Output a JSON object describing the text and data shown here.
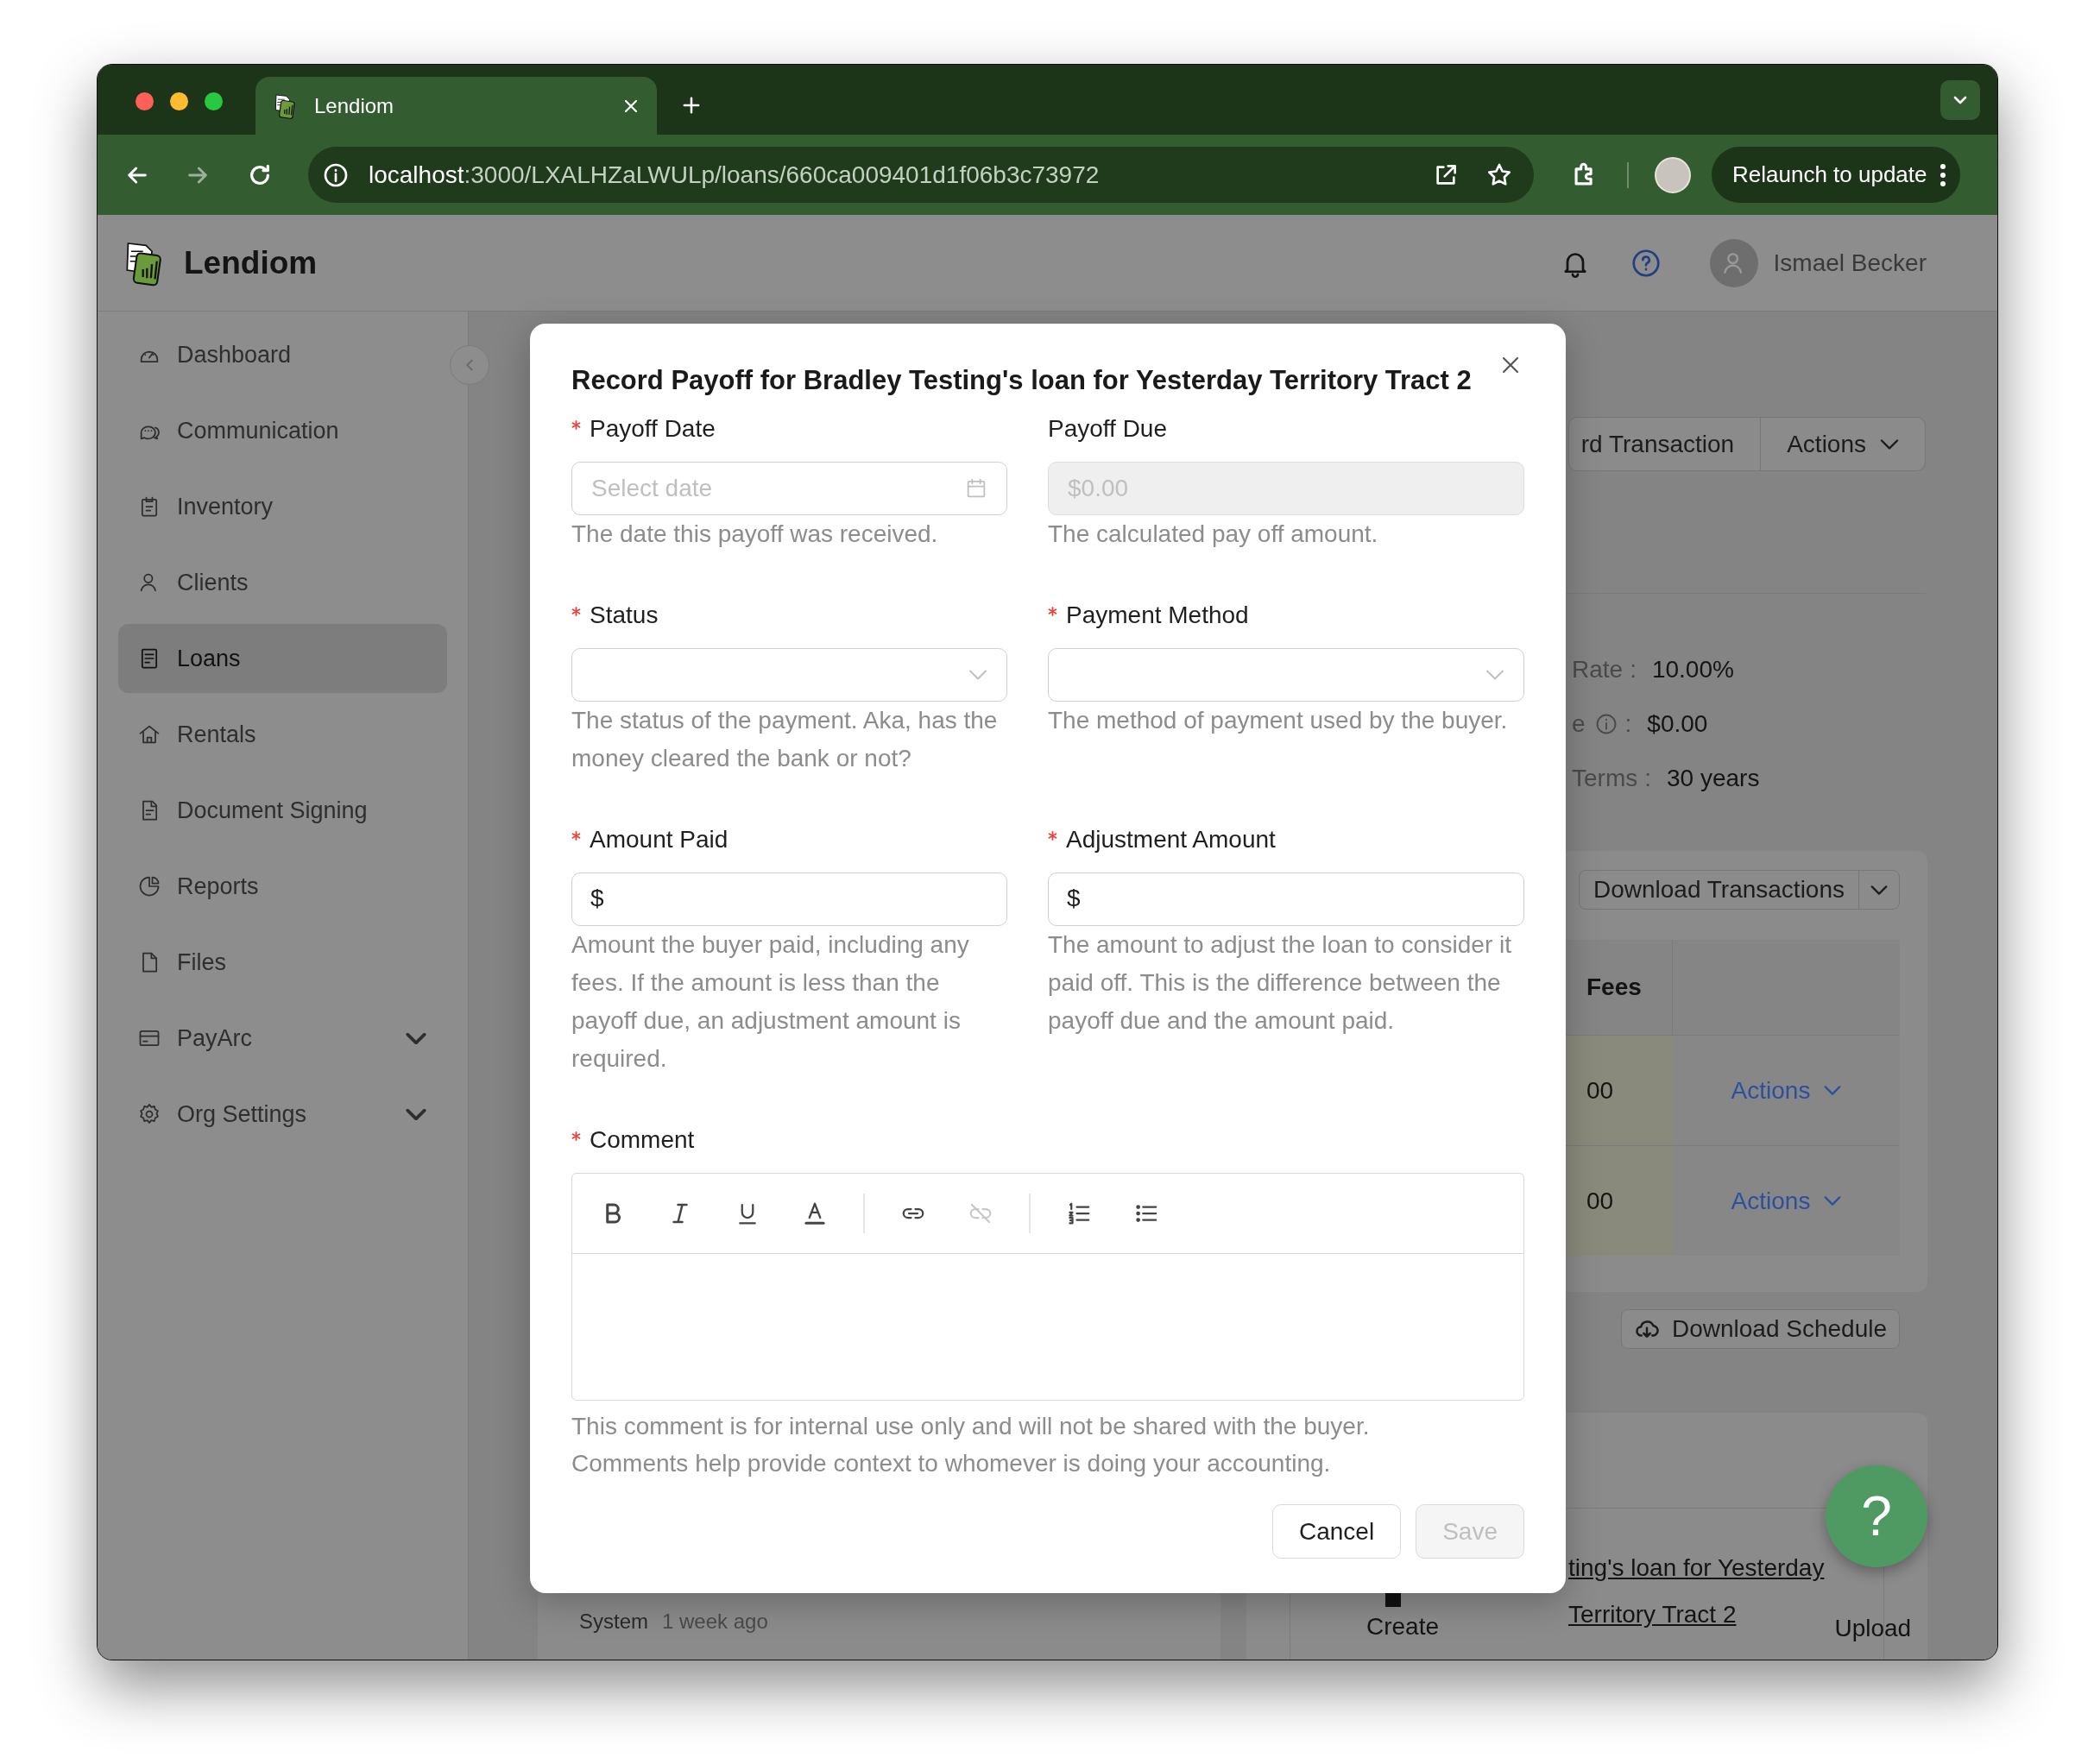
{
  "browser": {
    "tab_title": "Lendiom",
    "url_host": "localhost",
    "url_path": ":3000/LXALHZaLWULp/loans/660ca009401d1f06b3c73972",
    "relaunch_button": "Relaunch to update"
  },
  "header": {
    "brand": "Lendiom",
    "user": "Ismael Becker"
  },
  "sidebar": {
    "items": [
      {
        "label": "Dashboard",
        "selected": false,
        "expandable": false
      },
      {
        "label": "Communication",
        "selected": false,
        "expandable": false
      },
      {
        "label": "Inventory",
        "selected": false,
        "expandable": false
      },
      {
        "label": "Clients",
        "selected": false,
        "expandable": false
      },
      {
        "label": "Loans",
        "selected": true,
        "expandable": false
      },
      {
        "label": "Rentals",
        "selected": false,
        "expandable": false
      },
      {
        "label": "Document Signing",
        "selected": false,
        "expandable": false
      },
      {
        "label": "Reports",
        "selected": false,
        "expandable": false
      },
      {
        "label": "Files",
        "selected": false,
        "expandable": false
      },
      {
        "label": "PayArc",
        "selected": false,
        "expandable": true
      },
      {
        "label": "Org Settings",
        "selected": false,
        "expandable": true
      }
    ]
  },
  "background": {
    "header_buttons": [
      "rd Transaction",
      "Actions"
    ],
    "details": [
      {
        "label": "Rate",
        "info": false,
        "separator": ":",
        "value": "10.00%"
      },
      {
        "label": "e",
        "info": true,
        "separator": ":",
        "value": "$0.00"
      },
      {
        "label": "Terms",
        "info": false,
        "separator": ":",
        "value": "30 years"
      }
    ],
    "transactions": {
      "download_button": "Download Transactions",
      "columns": [
        "Fees"
      ],
      "rows": [
        {
          "fees": "00",
          "action": "Actions"
        },
        {
          "fees": "00",
          "action": "Actions"
        }
      ]
    },
    "schedule_button": "Download Schedule",
    "documents": {
      "link_lines": [
        "ting's loan for Yesterday",
        "Territory Tract 2"
      ],
      "actions": [
        "Create",
        "Upload"
      ]
    },
    "activity": {
      "author": "System",
      "time": "1 week ago"
    }
  },
  "modal": {
    "title": "Record Payoff for Bradley Testing's loan for Yesterday Territory Tract 2",
    "fields": [
      {
        "label": "Payoff Date",
        "required": true,
        "kind": "date",
        "placeholder": "Select date",
        "disabled": false,
        "help": "The date this payoff was received."
      },
      {
        "label": "Payoff Due",
        "required": false,
        "kind": "text",
        "placeholder": "$0.00",
        "disabled": true,
        "help": "The calculated pay off amount."
      },
      {
        "label": "Status",
        "required": true,
        "kind": "select",
        "disabled": false,
        "help": "The status of the payment. Aka, has the money cleared the bank or not?"
      },
      {
        "label": "Payment Method",
        "required": true,
        "kind": "select",
        "disabled": false,
        "help": "The method of payment used by the buyer."
      },
      {
        "label": "Amount Paid",
        "required": true,
        "kind": "money",
        "prefix": "$",
        "disabled": false,
        "help": "Amount the buyer paid, including any fees. If the amount is less than the payoff due, an adjustment amount is required."
      },
      {
        "label": "Adjustment Amount",
        "required": true,
        "kind": "money",
        "prefix": "$",
        "disabled": false,
        "help": "The amount to adjust the loan to consider it paid off. This is the difference between the payoff due and the amount paid."
      }
    ],
    "comment": {
      "label": "Comment",
      "required": true,
      "help": "This comment is for internal use only and will not be shared with the buyer. Comments help provide context to whomever is doing your accounting.",
      "tools": [
        {
          "kind": "bold",
          "disabled": false
        },
        {
          "kind": "italic",
          "disabled": false
        },
        {
          "kind": "underline",
          "disabled": false
        },
        {
          "kind": "color",
          "disabled": false
        },
        {
          "kind": "divider"
        },
        {
          "kind": "link",
          "disabled": false
        },
        {
          "kind": "unlink",
          "disabled": true
        },
        {
          "kind": "divider"
        },
        {
          "kind": "ordered",
          "disabled": false
        },
        {
          "kind": "bullets",
          "disabled": false
        }
      ]
    },
    "buttons": [
      {
        "label": "Cancel",
        "disabled": false
      },
      {
        "label": "Save",
        "disabled": true
      }
    ]
  },
  "help_button": "?"
}
